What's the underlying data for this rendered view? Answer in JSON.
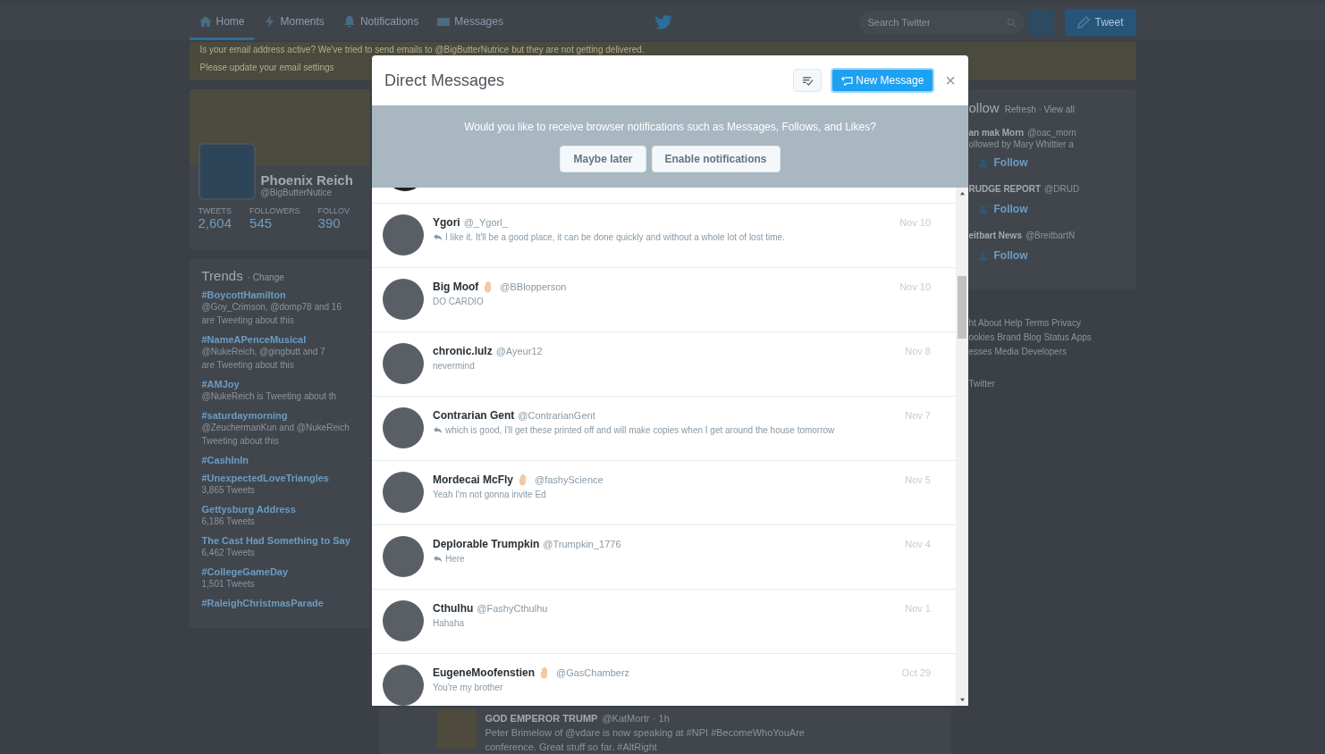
{
  "nav": {
    "tabs": [
      {
        "label": "Home",
        "selected": true
      },
      {
        "label": "Moments",
        "selected": false
      },
      {
        "label": "Notifications",
        "selected": false
      },
      {
        "label": "Messages",
        "selected": false
      }
    ],
    "search": {
      "placeholder": "Search Twitter"
    },
    "tweet_button": "Tweet"
  },
  "email_banner": [
    "Is your email address active? We've tried to send emails to @BigButterNutrice but they are not getting delivered.",
    "Please update your email settings"
  ],
  "profile": {
    "name": "Phoenix Reich",
    "handle": "@BigButterNutice",
    "stats": [
      {
        "label": "TWEETS",
        "value": "2,604"
      },
      {
        "label": "FOLLOWERS",
        "value": "545"
      },
      {
        "label": "FOLLOV",
        "value": "390"
      }
    ]
  },
  "trends": {
    "title": "Trends",
    "change": "· Change",
    "items": [
      {
        "name": "#BoycottHamilton",
        "detail": [
          "@Goy_Crimson, @domp78 and 16",
          "are Tweeting about this"
        ]
      },
      {
        "name": "#NameAPenceMusical",
        "detail": [
          "@NukeReich, @gingbutt and 7",
          "are Tweeting about this"
        ]
      },
      {
        "name": "#AMJoy",
        "detail": [
          "@NukeReich is Tweeting about th"
        ]
      },
      {
        "name": "#saturdaymorning",
        "detail": [
          "@ZeuchermanKun and @NukeReich",
          "Tweeting about this"
        ]
      },
      {
        "name": "#CashInIn"
      },
      {
        "name": "#UnexpectedLoveTriangles",
        "detail": [
          "3,865 Tweets"
        ]
      },
      {
        "name": "Gettysburg Address",
        "detail": [
          "6,186 Tweets"
        ]
      },
      {
        "name": "The Cast Had Something to Say",
        "detail": [
          "6,462 Tweets"
        ]
      },
      {
        "name": "#CollegeGameDay",
        "detail": [
          "1,501 Tweets"
        ]
      },
      {
        "name": "#RaleighChristmasParade"
      }
    ]
  },
  "who_to_follow": {
    "title": "ollow",
    "actions": "Refresh · View all",
    "accounts": [
      {
        "name": "an mak Morn",
        "handle": "@oac_morn",
        "note": "ollowed by Mary Whittier a",
        "follow": "Follow"
      },
      {
        "name": "RUDGE REPORT",
        "handle": "@DRUD",
        "follow": "Follow"
      },
      {
        "name": "eitbart News",
        "handle": "@BreitbartN",
        "follow": "Follow"
      }
    ]
  },
  "footer_links": [
    "ht  About  Help  Terms  Privacy",
    "ookies  Brand  Blog  Status  Apps",
    "esses  Media  Developers"
  ],
  "footer_copy": "Twitter",
  "timeline_tweet": {
    "name": "GOD EMPEROR TRUMP",
    "handle": "@KatMortr · 1h",
    "text": [
      "Peter Brimelow of @vdare is now speaking at #NPI #BecomeWhoYouAre",
      "conference. Great stuff so far. #AltRight"
    ]
  },
  "dm_modal": {
    "title": "Direct Messages",
    "new_message": "New Message",
    "close": "×",
    "prompt": {
      "text": "Would you like to receive browser notifications such as Messages, Follows, and Likes?",
      "buttons": [
        "Maybe later",
        "Enable notifications"
      ]
    },
    "conversations": [
      {
        "name": "Ygori",
        "badge": false,
        "handle": "@_Ygorl_",
        "reply": true,
        "message": "I like it. It'll be a good place, it can be done quickly and without a whole lot of lost time.",
        "date": "Nov 10"
      },
      {
        "name": "Big Moof",
        "badge": true,
        "handle": "@BBlopperson",
        "reply": false,
        "message": "DO CARDIO",
        "date": "Nov 10"
      },
      {
        "name": "chronic.lulz",
        "badge": false,
        "handle": "@Ayeur12",
        "reply": false,
        "message": "nevermind",
        "date": "Nov 8"
      },
      {
        "name": "Contrarian Gent",
        "badge": false,
        "handle": "@ContrarianGent",
        "reply": true,
        "message": "which is good, I'll get these printed off and will make copies when I get around the house tomorrow",
        "date": "Nov 7"
      },
      {
        "name": "Mordecai McFly",
        "badge": true,
        "handle": "@fashyScience",
        "reply": false,
        "message": "Yeah I'm not gonna invite Ed",
        "date": "Nov 5"
      },
      {
        "name": "Deplorable Trumpkin",
        "badge": false,
        "handle": "@Trumpkin_1776",
        "reply": true,
        "message": "Here",
        "date": "Nov 4"
      },
      {
        "name": "Cthulhu",
        "badge": false,
        "handle": "@FashyCthulhu",
        "reply": false,
        "message": "Hahaha",
        "date": "Nov 1"
      },
      {
        "name": "EugeneMoofenstien",
        "badge": true,
        "handle": "@GasChamberz",
        "reply": false,
        "message": "You're my brother",
        "date": "Oct 29"
      }
    ]
  }
}
